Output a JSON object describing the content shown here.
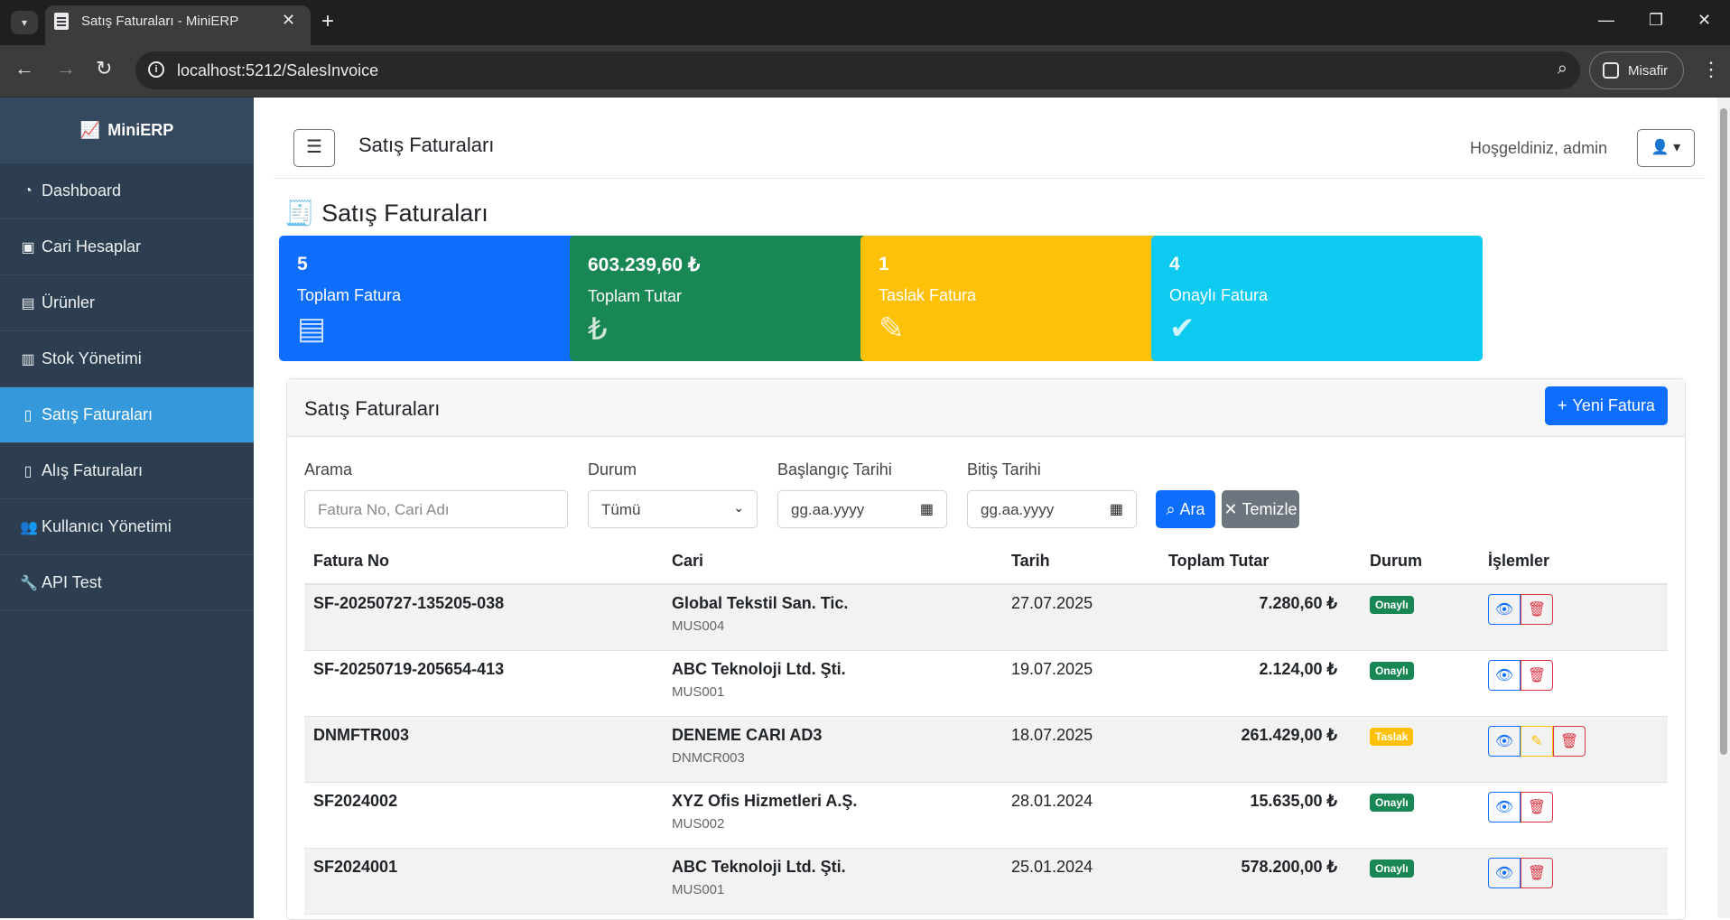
{
  "browser": {
    "tab_title": "Satış Faturaları - MiniERP",
    "url": "localhost:5212/SalesInvoice",
    "profile": "Misafir"
  },
  "sidebar": {
    "brand": "MiniERP",
    "items": [
      {
        "label": "Dashboard",
        "icon": "tachometer-icon"
      },
      {
        "label": "Cari Hesaplar",
        "icon": "address-card-icon"
      },
      {
        "label": "Ürünler",
        "icon": "box-icon"
      },
      {
        "label": "Stok Yönetimi",
        "icon": "warehouse-icon"
      },
      {
        "label": "Satış Faturaları",
        "icon": "invoice-dollar-icon",
        "active": true
      },
      {
        "label": "Alış Faturaları",
        "icon": "file-icon"
      },
      {
        "label": "Kullanıcı Yönetimi",
        "icon": "users-icon"
      },
      {
        "label": "API Test",
        "icon": "wrench-icon"
      }
    ]
  },
  "header": {
    "title": "Satış Faturaları",
    "welcome": "Hoşgeldiniz, admin"
  },
  "page": {
    "title": "Satış Faturaları"
  },
  "stats": [
    {
      "value": "5",
      "label": "Toplam Fatura",
      "color": "#0d6efd",
      "icon": "invoice-icon"
    },
    {
      "value": "603.239,60 ₺",
      "label": "Toplam Tutar",
      "color": "#198754",
      "icon": "lira-icon"
    },
    {
      "value": "1",
      "label": "Taslak Fatura",
      "color": "#ffc107",
      "icon": "edit-icon"
    },
    {
      "value": "4",
      "label": "Onaylı Fatura",
      "color": "#0dcaf0",
      "icon": "check-circle-icon"
    }
  ],
  "panel": {
    "title": "Satış Faturaları",
    "new_button": "Yeni Fatura"
  },
  "filters": {
    "search_label": "Arama",
    "search_placeholder": "Fatura No, Cari Adı",
    "status_label": "Durum",
    "status_value": "Tümü",
    "start_label": "Başlangıç Tarihi",
    "start_placeholder": "gg.aa.yyyy",
    "end_label": "Bitiş Tarihi",
    "end_placeholder": "gg.aa.yyyy",
    "search_button": "Ara",
    "clear_button": "Temizle"
  },
  "table": {
    "columns": [
      "Fatura No",
      "Cari",
      "Tarih",
      "Toplam Tutar",
      "Durum",
      "İşlemler"
    ],
    "rows": [
      {
        "no": "SF-20250727-135205-038",
        "cari": "Global Tekstil San. Tic.",
        "code": "MUS004",
        "date": "27.07.2025",
        "total": "7.280,60 ₺",
        "status": "Onaylı",
        "status_color": "#198754",
        "editable": false
      },
      {
        "no": "SF-20250719-205654-413",
        "cari": "ABC Teknoloji Ltd. Şti.",
        "code": "MUS001",
        "date": "19.07.2025",
        "total": "2.124,00 ₺",
        "status": "Onaylı",
        "status_color": "#198754",
        "editable": false
      },
      {
        "no": "DNMFTR003",
        "cari": "DENEME CARI AD3",
        "code": "DNMCR003",
        "date": "18.07.2025",
        "total": "261.429,00 ₺",
        "status": "Taslak",
        "status_color": "#ffc107",
        "editable": true
      },
      {
        "no": "SF2024002",
        "cari": "XYZ Ofis Hizmetleri A.Ş.",
        "code": "MUS002",
        "date": "28.01.2024",
        "total": "15.635,00 ₺",
        "status": "Onaylı",
        "status_color": "#198754",
        "editable": false
      },
      {
        "no": "SF2024001",
        "cari": "ABC Teknoloji Ltd. Şti.",
        "code": "MUS001",
        "date": "25.01.2024",
        "total": "578.200,00 ₺",
        "status": "Onaylı",
        "status_color": "#198754",
        "editable": false
      }
    ]
  }
}
